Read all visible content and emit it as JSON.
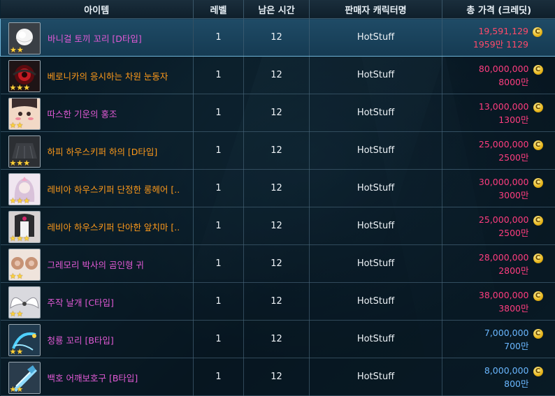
{
  "columns": {
    "item": "아이템",
    "level": "레벨",
    "time": "남은 시간",
    "seller": "판매자 캐릭터명",
    "price": "총 가격 (크레딧)"
  },
  "colors": {
    "name_magenta": "#e25ad6",
    "name_orange": "#ff9a1a",
    "price_pink": "#ff3d7f",
    "price_blue": "#6ab7ff",
    "selected_row": "#1f4b66"
  },
  "coin_glyph": "C",
  "rows": [
    {
      "name": "바니걸 토끼 꼬리 [D타입]",
      "name_color": "#e25ad6",
      "level": "1",
      "time": "12",
      "seller": "HotStuff",
      "price": "19,591,129",
      "price_short": "1959만 1129",
      "price_color": "#ff4a6a",
      "stars": 2,
      "icon": "bunny-tail-icon",
      "selected": true
    },
    {
      "name": "베로니카의 응시하는 차원 눈동자",
      "name_color": "#ff9a1a",
      "level": "1",
      "time": "12",
      "seller": "HotStuff",
      "price": "80,000,000",
      "price_short": "8000만",
      "price_color": "#ff3d7f",
      "stars": 3,
      "icon": "dimension-eye-icon",
      "selected": false
    },
    {
      "name": "따스한 기운의 홍조",
      "name_color": "#e25ad6",
      "level": "1",
      "time": "12",
      "seller": "HotStuff",
      "price": "13,000,000",
      "price_short": "1300만",
      "price_color": "#ff3d7f",
      "stars": 2,
      "icon": "blush-face-icon",
      "selected": false
    },
    {
      "name": "하피 하우스키퍼 하의 [D타입]",
      "name_color": "#ff9a1a",
      "level": "1",
      "time": "12",
      "seller": "HotStuff",
      "price": "25,000,000",
      "price_short": "2500만",
      "price_color": "#ff3d7f",
      "stars": 3,
      "icon": "skirt-icon",
      "selected": false
    },
    {
      "name": "레비아 하우스키퍼 단정한 롱헤어 [..",
      "name_color": "#ff9a1a",
      "level": "1",
      "time": "12",
      "seller": "HotStuff",
      "price": "30,000,000",
      "price_short": "3000만",
      "price_color": "#ff3d7f",
      "stars": 3,
      "icon": "long-hair-icon",
      "selected": false
    },
    {
      "name": "레비아 하우스키퍼 단아한 앞치마 [..",
      "name_color": "#ff9a1a",
      "level": "1",
      "time": "12",
      "seller": "HotStuff",
      "price": "25,000,000",
      "price_short": "2500만",
      "price_color": "#ff3d7f",
      "stars": 3,
      "icon": "apron-icon",
      "selected": false
    },
    {
      "name": "그레모리 박사의 곰인형 귀",
      "name_color": "#e25ad6",
      "level": "1",
      "time": "12",
      "seller": "HotStuff",
      "price": "28,000,000",
      "price_short": "2800만",
      "price_color": "#ff3d7f",
      "stars": 2,
      "icon": "bear-ears-icon",
      "selected": false
    },
    {
      "name": "주작 날개 [C타입]",
      "name_color": "#e25ad6",
      "level": "1",
      "time": "12",
      "seller": "HotStuff",
      "price": "38,000,000",
      "price_short": "3800만",
      "price_color": "#ff3d7f",
      "stars": 2,
      "icon": "wings-icon",
      "selected": false
    },
    {
      "name": "청룡 꼬리 [B타입]",
      "name_color": "#e25ad6",
      "level": "1",
      "time": "12",
      "seller": "HotStuff",
      "price": "7,000,000",
      "price_short": "700만",
      "price_color": "#6ab7ff",
      "stars": 2,
      "icon": "dragon-tail-icon",
      "selected": false
    },
    {
      "name": "백호 어깨보호구 [B타입]",
      "name_color": "#e25ad6",
      "level": "1",
      "time": "12",
      "seller": "HotStuff",
      "price": "8,000,000",
      "price_short": "800만",
      "price_color": "#6ab7ff",
      "stars": 2,
      "icon": "shoulder-guard-icon",
      "selected": false
    }
  ]
}
